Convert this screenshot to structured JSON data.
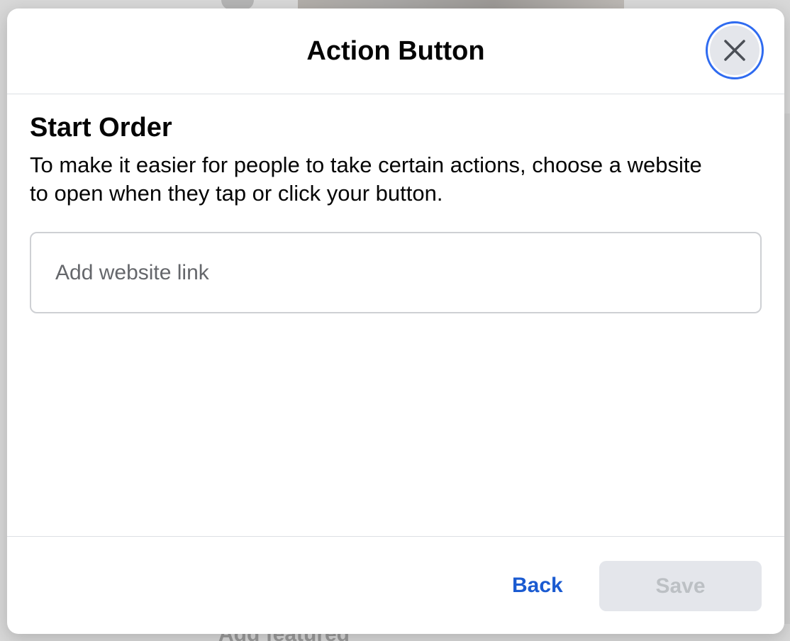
{
  "background": {
    "partial_text": "Add featured"
  },
  "dialog": {
    "title": "Action Button",
    "close_icon": "close-icon"
  },
  "section": {
    "title": "Start Order",
    "description": "To make it easier for people to take certain actions, choose a website to open when they tap or click your button."
  },
  "website_input": {
    "value": "",
    "placeholder": "Add website link"
  },
  "footer": {
    "back_label": "Back",
    "save_label": "Save",
    "save_disabled": true
  },
  "colors": {
    "accent": "#1b5bd1",
    "focus_ring": "#2f6bf0",
    "disabled_bg": "#e4e6eb",
    "disabled_text": "#bcc0c4"
  }
}
